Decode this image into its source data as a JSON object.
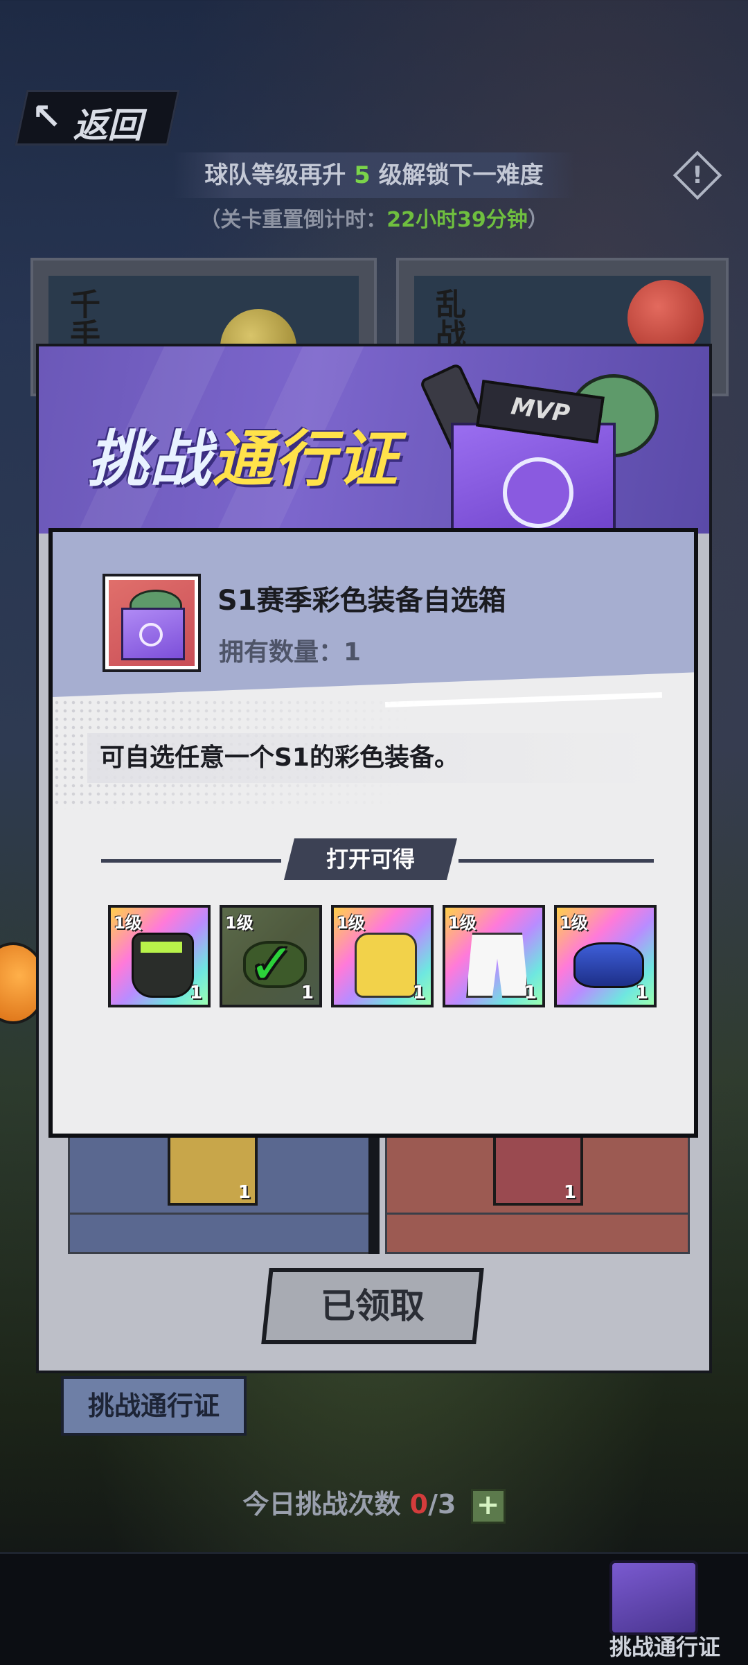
{
  "topbar": {
    "back_label": "返回",
    "unlock_prefix": "球队等级再升 ",
    "unlock_levels": "5",
    "unlock_suffix": " 级解锁下一难度",
    "reset_prefix": "（关卡重置倒计时：",
    "reset_time": "22小时39分钟",
    "reset_suffix": "）",
    "alert_glyph": "!"
  },
  "background_cards": {
    "left_name": "千手",
    "right_name": "乱战"
  },
  "pass_panel": {
    "title_part1": "挑战",
    "title_part2": "通行证",
    "box_badge": "MVP",
    "claim_button": "已领取",
    "bg_item_qty_left": "1",
    "bg_item_qty_right": "1"
  },
  "pass_tab": {
    "label": "挑战通行证"
  },
  "attempts": {
    "label": "今日挑战次数",
    "used": "0",
    "total": "/3",
    "plus": "+"
  },
  "bottom_nav": {
    "pass_label": "挑战通行证"
  },
  "item_dialog": {
    "name": "S1赛季彩色装备自选箱",
    "count_label": "拥有数量：",
    "count_value": "1",
    "description": "可自选任意一个S1的彩色装备。",
    "section_label": "打开可得",
    "rewards": [
      {
        "level": "1级",
        "qty": "1",
        "icon": "goalkeeper-gloves-icon",
        "selected": false
      },
      {
        "level": "1级",
        "qty": "1",
        "icon": "goggles-icon",
        "selected": true
      },
      {
        "level": "1级",
        "qty": "1",
        "icon": "hand-wrap-icon",
        "selected": false
      },
      {
        "level": "1级",
        "qty": "1",
        "icon": "shorts-icon",
        "selected": false
      },
      {
        "level": "1级",
        "qty": "1",
        "icon": "headband-icon",
        "selected": false
      }
    ]
  },
  "colors": {
    "accent_green": "#7bd44a",
    "pass_purple": "#7c66cc",
    "dialog_header": "#a6aed0",
    "attempts_red": "#d43c3c"
  }
}
